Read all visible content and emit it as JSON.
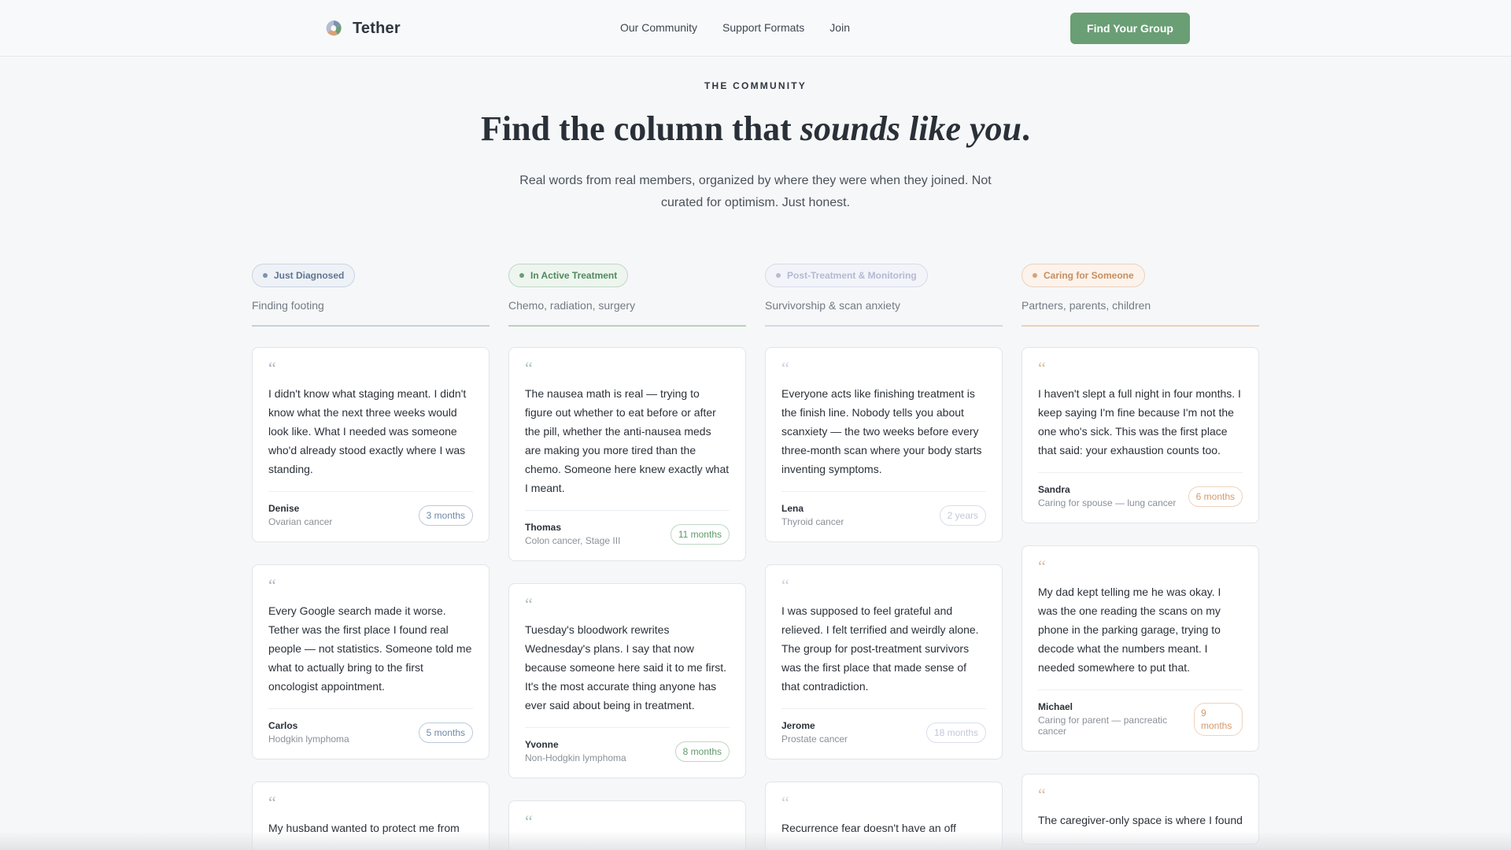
{
  "header": {
    "brand": "Tether",
    "nav": [
      "Our Community",
      "Support Formats",
      "Join"
    ],
    "cta": "Find Your Group"
  },
  "hero": {
    "eyebrow": "THE COMMUNITY",
    "title_prefix": "Find the column that ",
    "title_emphasis": "sounds like you",
    "title_suffix": ".",
    "subtitle": "Real words from real members, organized by where they were when they joined. Not curated for optimism. Just honest."
  },
  "colors": {
    "blue": "#7d93ad",
    "green": "#6a9e74",
    "lavender": "#b6bbd4",
    "orange": "#d9a176",
    "cta": "#6a9e74"
  },
  "columns": [
    {
      "label": "Just Diagnosed",
      "subtitle": "Finding footing",
      "cards": [
        {
          "quote": "I didn't know what staging meant. I didn't know what the next three weeks would look like. What I needed was someone who'd already stood exactly where I was standing.",
          "name": "Denise",
          "desc": "Ovarian cancer",
          "duration": "3 months"
        },
        {
          "quote": "Every Google search made it worse. Tether was the first place I found real people — not statistics. Someone told me what to actually bring to the first oncologist appointment.",
          "name": "Carlos",
          "desc": "Hodgkin lymphoma",
          "duration": "5 months"
        },
        {
          "quote": "My husband wanted to protect me from",
          "name": "",
          "desc": "",
          "duration": ""
        }
      ]
    },
    {
      "label": "In Active Treatment",
      "subtitle": "Chemo, radiation, surgery",
      "cards": [
        {
          "quote": "The nausea math is real — trying to figure out whether to eat before or after the pill, whether the anti-nausea meds are making you more tired than the chemo. Someone here knew exactly what I meant.",
          "name": "Thomas",
          "desc": "Colon cancer, Stage III",
          "duration": "11 months"
        },
        {
          "quote": "Tuesday's bloodwork rewrites Wednesday's plans. I say that now because someone here said it to me first. It's the most accurate thing anyone has ever said about being in treatment.",
          "name": "Yvonne",
          "desc": "Non-Hodgkin lymphoma",
          "duration": "8 months"
        },
        {
          "quote": "",
          "name": "",
          "desc": "",
          "duration": ""
        }
      ]
    },
    {
      "label": "Post-Treatment & Monitoring",
      "subtitle": "Survivorship & scan anxiety",
      "cards": [
        {
          "quote": "Everyone acts like finishing treatment is the finish line. Nobody tells you about scanxiety — the two weeks before every three-month scan where your body starts inventing symptoms.",
          "name": "Lena",
          "desc": "Thyroid cancer",
          "duration": "2 years"
        },
        {
          "quote": "I was supposed to feel grateful and relieved. I felt terrified and weirdly alone. The group for post-treatment survivors was the first place that made sense of that contradiction.",
          "name": "Jerome",
          "desc": "Prostate cancer",
          "duration": "18 months"
        },
        {
          "quote": "Recurrence fear doesn't have an off",
          "name": "",
          "desc": "",
          "duration": ""
        }
      ]
    },
    {
      "label": "Caring for Someone",
      "subtitle": "Partners, parents, children",
      "cards": [
        {
          "quote": "I haven't slept a full night in four months. I keep saying I'm fine because I'm not the one who's sick. This was the first place that said: your exhaustion counts too.",
          "name": "Sandra",
          "desc": "Caring for spouse — lung cancer",
          "duration": "6 months"
        },
        {
          "quote": "My dad kept telling me he was okay. I was the one reading the scans on my phone in the parking garage, trying to decode what the numbers meant. I needed somewhere to put that.",
          "name": "Michael",
          "desc": "Caring for parent — pancreatic cancer",
          "duration": "9 months"
        },
        {
          "quote": "The caregiver-only space is where I found",
          "name": "",
          "desc": "",
          "duration": ""
        }
      ]
    }
  ]
}
